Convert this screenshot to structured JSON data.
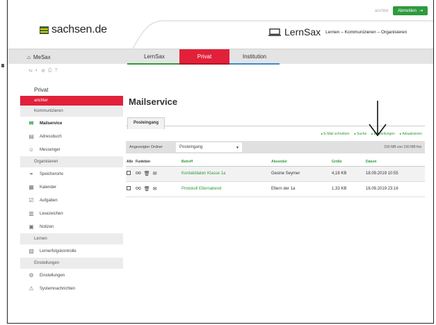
{
  "header": {
    "user_name": "arichter",
    "logout_label": "Abmelden",
    "sachsen_brand": "sachsen.de",
    "lernsax_brand": "LernSax",
    "lernsax_tagline": "Lernen – Kommunizieren – Organisieren"
  },
  "nav": {
    "home": "MeSax",
    "tabs": [
      "LernSax",
      "Privat",
      "Institution"
    ]
  },
  "sidebar": {
    "title": "Privat",
    "user": "arichter",
    "sections": {
      "kommunizieren": "Kommunizieren",
      "organisieren": "Organisieren",
      "lernen": "Lernen",
      "einstellungen": "Einstellungen"
    },
    "items": {
      "mailservice": "Mailservice",
      "adressbuch": "Adressbuch",
      "messenger": "Messenger",
      "speicherorte": "Speicherorte",
      "kalender": "Kalender",
      "aufgaben": "Aufgaben",
      "lesezeichen": "Lesezeichen",
      "notizen": "Notizen",
      "lernerfolgskontrolle": "Lernerfolgskontrolle",
      "einstellungen": "Einstellungen",
      "systemnachrichten": "Systemnachrichten"
    }
  },
  "main": {
    "title": "Mailservice",
    "tab": "Posteingang",
    "actions": [
      "E-Mail schreiben",
      "Suche",
      "Einstellungen",
      "Aktualisieren"
    ],
    "folder_label": "Angezeigter Ordner",
    "folder_value": "Posteingang",
    "quota": "150 MB von 150 MB frei",
    "columns": {
      "alle": "Alle",
      "funktion": "Funktion",
      "betreff": "Betreff",
      "absender": "Absender",
      "groesse": "Größe",
      "datum": "Datum"
    },
    "rows": [
      {
        "subject": "Kontaktdaten Klasse 1a",
        "sender": "Gesine Seymer",
        "size": "4,18 KB",
        "date": "18.09.2019 10:55"
      },
      {
        "subject": "Protokoll Elternabend",
        "sender": "Eltern der 1a",
        "size": "1,33 KB",
        "date": "16.09.2019 23:16"
      }
    ]
  },
  "colors": {
    "accent_green": "#2e9a3e",
    "accent_red": "#e2203a",
    "accent_blue": "#3a8ad0"
  }
}
